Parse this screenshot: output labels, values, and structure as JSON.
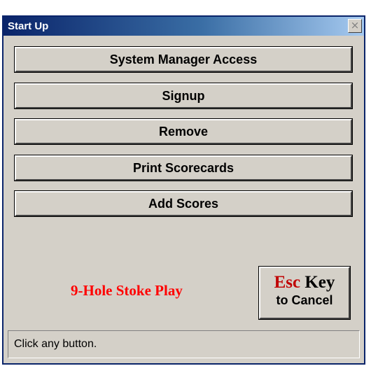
{
  "window": {
    "title": "Start Up",
    "close_glyph": "×",
    "close_icon": "close-icon"
  },
  "buttons": [
    {
      "label": "System Manager Access"
    },
    {
      "label": "Signup"
    },
    {
      "label": "Remove"
    },
    {
      "label": "Print Scorecards"
    },
    {
      "label": "Add Scores"
    }
  ],
  "mode_label": "9-Hole Stoke Play",
  "esc_button": {
    "key": "Esc",
    "word": "Key",
    "subtitle": "to Cancel"
  },
  "status": {
    "text": "Click any button."
  },
  "colors": {
    "title_bar": "#0a246a",
    "face": "#d4d0c8",
    "mode_label": "#ff0000",
    "esc_key": "#c00000"
  }
}
